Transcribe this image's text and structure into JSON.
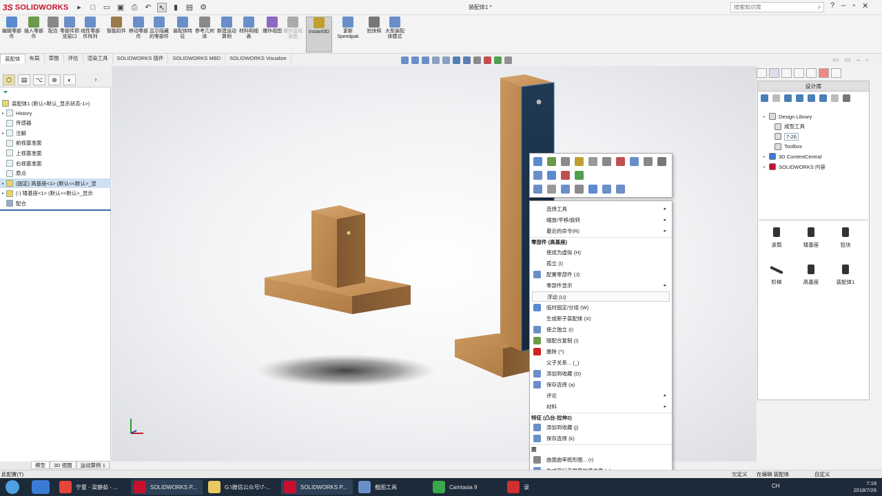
{
  "app": {
    "brand": "SOLIDWORKS",
    "brand_prefix": "3S",
    "doc_title": "装配体1 *"
  },
  "search": {
    "placeholder": "搜索知识库"
  },
  "ribbon": {
    "buttons": [
      {
        "label": "编辑零部件",
        "icon": "edit-component-icon"
      },
      {
        "label": "插入零部件",
        "icon": "insert-component-icon"
      },
      {
        "label": "配合",
        "icon": "mate-icon"
      },
      {
        "label": "零部件预览窗口",
        "icon": "preview-window-icon"
      },
      {
        "label": "线性零部件阵列",
        "icon": "linear-pattern-icon"
      },
      {
        "label": "智能扣件",
        "icon": "smart-fastener-icon"
      },
      {
        "label": "移动零部件",
        "icon": "move-component-icon"
      },
      {
        "label": "显示隐藏的零部件",
        "icon": "show-hidden-icon"
      },
      {
        "label": "装配体特征",
        "icon": "assembly-feature-icon"
      },
      {
        "label": "参考几何体",
        "icon": "reference-geometry-icon"
      },
      {
        "label": "新建运动算例",
        "icon": "new-motion-study-icon"
      },
      {
        "label": "材料明细表",
        "icon": "bom-icon"
      },
      {
        "label": "爆炸视图",
        "icon": "exploded-view-icon"
      },
      {
        "label": "爆炸直线草图",
        "icon": "explode-line-icon"
      },
      {
        "label": "Instant3D",
        "icon": "instant3d-icon"
      },
      {
        "label": "更新Speedpak",
        "icon": "speedpak-icon"
      },
      {
        "label": "拍快照",
        "icon": "snapshot-icon"
      },
      {
        "label": "大型装配体模式",
        "icon": "large-assembly-icon"
      }
    ]
  },
  "command_tabs": [
    "装配体",
    "布局",
    "草图",
    "评估",
    "渲染工具",
    "SOLIDWORKS 插件",
    "SOLIDWORKS MBD",
    "SOLIDWORKS Visualize"
  ],
  "tree": {
    "root": "装配体1 (默认<默认_显示状态-1>)",
    "items": [
      "History",
      "传感器",
      "注解",
      "前视基准面",
      "上视基准面",
      "右视基准面",
      "原点",
      "(固定) 高基座<1> (默认<<默认>_显",
      "(-) 矮基座<1> (默认<<默认>_显示",
      "配合"
    ]
  },
  "bottom_tabs": [
    "模型",
    "3D 视图",
    "运动算例 1"
  ],
  "design_library": {
    "title": "设计库",
    "tree": [
      "Design Library",
      "成型工具",
      "7-26",
      "Toolbox",
      "3D ContentCentral",
      "SOLIDWORKS 内容"
    ],
    "tiles": [
      "滚筒",
      "矮基座",
      "铅块",
      "阶梯",
      "高基座",
      "装配体1"
    ]
  },
  "context_menu": {
    "items": [
      {
        "label": "选择工具",
        "submenu": true
      },
      {
        "label": "缩放/平移/旋转",
        "submenu": true
      },
      {
        "label": "最近的命令(R)",
        "submenu": true
      },
      {
        "header": "零部件 (高基座)"
      },
      {
        "label": "使成为虚拟 (H)"
      },
      {
        "label": "孤立 (I)"
      },
      {
        "label": "配置零部件 (J)",
        "icon": "configure-icon"
      },
      {
        "label": "零部件显示",
        "submenu": true
      },
      {
        "label": "浮动 (U)",
        "hover": true
      },
      {
        "label": "临时固定/分组 (W)",
        "icon": "fix-group-icon"
      },
      {
        "label": "生成新子装配体 (X)"
      },
      {
        "label": "使之独立 (I)",
        "icon": "make-independent-icon"
      },
      {
        "label": "随配合复制 (I)",
        "icon": "copy-with-mates-icon"
      },
      {
        "label": "删除 (^)",
        "icon": "delete-icon"
      },
      {
        "label": "父子关系... (_)"
      },
      {
        "label": "添加到收藏 (D)",
        "icon": "favorite-icon"
      },
      {
        "label": "保存选择 (a)",
        "icon": "save-selection-icon"
      },
      {
        "label": "评论",
        "submenu": true
      },
      {
        "label": "材料",
        "submenu": true
      },
      {
        "header": "特征 (凸台-拉伸2)"
      },
      {
        "label": "添加到收藏 (j)",
        "icon": "favorite-icon"
      },
      {
        "label": "保存选择 (k)",
        "icon": "save-selection-icon"
      },
      {
        "header": "面"
      },
      {
        "label": "曲面曲率梳形图... (r)",
        "icon": "curvature-icon"
      },
      {
        "label": "生成平行于屏幕的基准面 (u)",
        "icon": "plane-icon"
      }
    ],
    "more": "⌄"
  },
  "statusbar": {
    "left": "此配置(T)",
    "center1": "欠定义",
    "center2": "在编辑 装配体",
    "right": "自定义"
  },
  "taskbar": {
    "items": [
      {
        "label": "宁夏 - 梁静茹 - ...",
        "color": "#e8443a"
      },
      {
        "label": "SOLIDWORKS P...",
        "color": "#c8102e"
      },
      {
        "label": "G:\\微信公众号\\7-...",
        "color": "#e8c860"
      },
      {
        "label": "SOLIDWORKS P...",
        "color": "#c8102e"
      },
      {
        "label": "截图工具",
        "color": "#6a8fc8"
      },
      {
        "label": "Camtasia 9",
        "color": "#3aa84a"
      },
      {
        "label": "录",
        "color": "#d03030"
      }
    ],
    "tray": "CH",
    "time": "7:18",
    "date": "2018/7/26"
  },
  "colors": {
    "wood": "#c8965c",
    "wood_dark": "#9a6a3c",
    "accent": "#c8102e",
    "selected_face": "#1f3a55"
  }
}
